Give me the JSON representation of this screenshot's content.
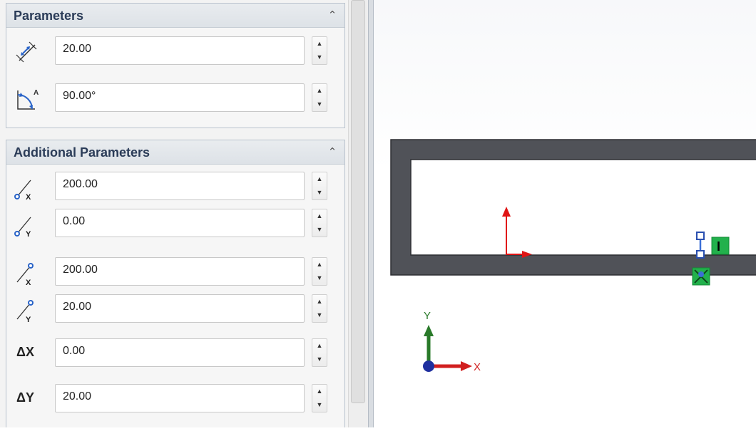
{
  "parameters": {
    "title": "Parameters",
    "fields": [
      {
        "icon": "length-dimension-icon",
        "value": "20.00"
      },
      {
        "icon": "angle-dimension-icon",
        "value": "90.00°"
      }
    ]
  },
  "additional": {
    "title": "Additional Parameters",
    "fields": [
      {
        "icon": "start-x-icon",
        "value": "200.00"
      },
      {
        "icon": "start-y-icon",
        "value": "0.00"
      },
      {
        "icon": "end-x-icon",
        "value": "200.00"
      },
      {
        "icon": "end-y-icon",
        "value": "20.00"
      },
      {
        "label": "ΔX",
        "value": "0.00"
      },
      {
        "label": "ΔY",
        "value": "20.00"
      }
    ]
  },
  "graphics": {
    "triad_y_label": "Y",
    "triad_x_label": "X",
    "relation_label": "I",
    "colors": {
      "profile": "#505258",
      "selected_line": "#3b6fd6",
      "relation": "#22b14c",
      "triad_x": "#d11f1f",
      "triad_y": "#2a7a2a",
      "origin": "#1f2f9f"
    }
  }
}
